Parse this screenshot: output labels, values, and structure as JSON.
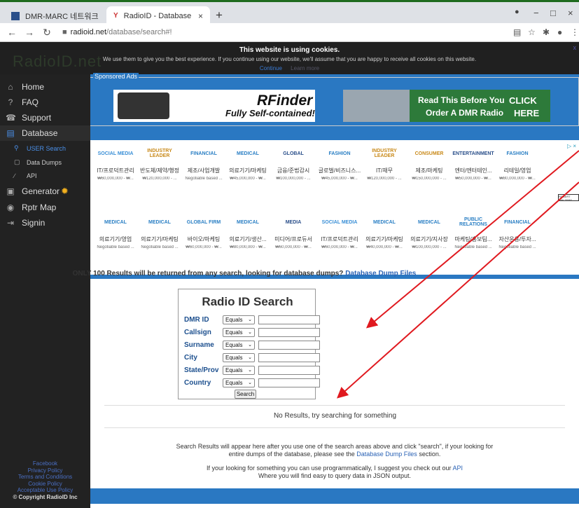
{
  "browser": {
    "tabs": [
      {
        "label": "DMR-MARC 네트워크"
      },
      {
        "label": "RadioID - Database",
        "icon": "Y"
      }
    ],
    "new_tab": "+",
    "url_host": "radioid.net",
    "url_path": "/database/search#!"
  },
  "site": {
    "logo": "RadioID.net",
    "cookie": {
      "title": "This website is using cookies.",
      "text": "We use them to give you the best experience. If you continue using our website, we'll assume that you are happy to receive all cookies on this website.",
      "continue": "Continue",
      "learn_more": "Learn more",
      "close": "x"
    }
  },
  "sidebar": {
    "items": [
      {
        "label": "Home",
        "icon": "⌂"
      },
      {
        "label": "FAQ",
        "icon": "?"
      },
      {
        "label": "Support",
        "icon": "☎"
      },
      {
        "label": "Database",
        "icon": "▤"
      },
      {
        "label": "USER Search",
        "icon": "⚲"
      },
      {
        "label": "Data Dumps",
        "icon": "▢"
      },
      {
        "label": "API",
        "icon": "∕"
      },
      {
        "label": "Generator",
        "icon": "▣",
        "badge": "✹"
      },
      {
        "label": "Rptr Map",
        "icon": "◉"
      },
      {
        "label": "Signin",
        "icon": "⇥"
      }
    ],
    "footer": [
      "Facebook",
      "Privacy Policy",
      "Terms and Conditions",
      "Cookie Policy",
      "Acceptable Use Policy"
    ],
    "copyright": "© Copyright RadioID Inc"
  },
  "ads": {
    "label": "Sponsored Ads",
    "rfinder_title": "RFinder",
    "rfinder_sub": "Fully Self-contained!",
    "dmr_line1": "Read This Before You",
    "dmr_line2": "Order A DMR Radio",
    "dmr_click1": "CLICK",
    "dmr_click2": "HERE",
    "adchoice": "▷ ×",
    "robert": "ROBERT WALTERS"
  },
  "jobs": [
    {
      "logo": "SOCIAL MEDIA",
      "title": "IT/프로덕트관리",
      "salary": "₩60,000,000 - ₩...",
      "color": "#3a8fd6"
    },
    {
      "logo": "INDUSTRY LEADER",
      "title": "반도체/제약/행정",
      "salary": "₩120,000,000 - ...",
      "color": "#c98a1a"
    },
    {
      "logo": "FINANCIAL",
      "title": "제조/사업개발",
      "salary": "Negotiable based ...",
      "color": "#2a7fc4"
    },
    {
      "logo": "MEDICAL",
      "title": "의료기기/마케팅",
      "salary": "₩45,000,000 - ₩...",
      "color": "#2a7fc4"
    },
    {
      "logo": "GLOBAL",
      "title": "금융/준법감시",
      "salary": "₩100,000,000 - ...",
      "color": "#2a4f8a"
    },
    {
      "logo": "FASHION",
      "title": "글로벌/비즈니스...",
      "salary": "₩45,000,000 - ₩...",
      "color": "#2a7fc4"
    },
    {
      "logo": "INDUSTRY LEADER",
      "title": "IT/재무",
      "salary": "₩120,000,000 - ...",
      "color": "#c98a1a"
    },
    {
      "logo": "CONSUMER",
      "title": "제조/마케팅",
      "salary": "₩150,000,000 - ...",
      "color": "#c98a1a"
    },
    {
      "logo": "ENTERTAINMENT",
      "title": "엔터/엔터테인...",
      "salary": "₩50,000,000 - ₩...",
      "color": "#2a4f8a"
    },
    {
      "logo": "FASHION",
      "title": "리테일/영업",
      "salary": "₩80,000,000 - ₩...",
      "color": "#2a7fc4"
    },
    {
      "logo": "MEDICAL",
      "title": "의료기기/영업",
      "salary": "Negotiable based ...",
      "color": "#2a7fc4"
    },
    {
      "logo": "MEDICAL",
      "title": "의료기기/마케팅",
      "salary": "Negotiable based ...",
      "color": "#2a7fc4"
    },
    {
      "logo": "GLOBAL FIRM",
      "title": "바이오/마케팅",
      "salary": "₩60,000,000 - ₩...",
      "color": "#2a7fc4"
    },
    {
      "logo": "MEDICAL",
      "title": "의료기기/생산...",
      "salary": "₩80,000,000 - ₩...",
      "color": "#2a7fc4"
    },
    {
      "logo": "MEDIA",
      "title": "미디어/프로듀서",
      "salary": "₩60,000,000 - ₩...",
      "color": "#2a4f8a"
    },
    {
      "logo": "SOCIAL MEDIA",
      "title": "IT/프로덕트관리",
      "salary": "₩60,000,000 - ₩...",
      "color": "#3a8fd6"
    },
    {
      "logo": "MEDICAL",
      "title": "의료기기/마케팅",
      "salary": "₩40,000,000 - ₩...",
      "color": "#2a7fc4"
    },
    {
      "logo": "MEDICAL",
      "title": "의료기기/지사장",
      "salary": "₩100,000,000 - ...",
      "color": "#2a7fc4"
    },
    {
      "logo": "PUBLIC RELATIONS",
      "title": "마케팅/홍보팀...",
      "salary": "Negotiable based ...",
      "color": "#2a7fc4"
    },
    {
      "logo": "FINANCIAL",
      "title": "자산운용/투자...",
      "salary": "Negotiable based ...",
      "color": "#2a7fc4"
    }
  ],
  "notice": {
    "text": "ONLY 100 Results will be returned from any search, looking for database dumps?",
    "link": "Database Dump Files"
  },
  "search": {
    "title": "Radio ID Search",
    "rows": [
      {
        "label": "DMR ID",
        "op": "Equals"
      },
      {
        "label": "Callsign",
        "op": "Equals"
      },
      {
        "label": "Surname",
        "op": "Equals"
      },
      {
        "label": "City",
        "op": "Equals"
      },
      {
        "label": "State/Prov",
        "op": "Equals"
      },
      {
        "label": "Country",
        "op": "Equals"
      }
    ],
    "button": "Search"
  },
  "results": {
    "empty": "No Results, try searching for something",
    "info1a": "Search Results will appear here after you use one of the search areas above and click \"search\", if your looking for",
    "info1b": "entire dumps of the database, please see the",
    "info1_link": "Database Dump Files",
    "info1_end": "section.",
    "info2a": "If your looking for something you can use programmatically, I suggest you check out our",
    "info2_link": "API",
    "info2b": "Where you will find easy to query data in JSON output."
  },
  "colors": {
    "accent": "#2a78c2",
    "arrow": "#e0191f",
    "sidebar": "#222222",
    "label": "#1c4f8e"
  }
}
